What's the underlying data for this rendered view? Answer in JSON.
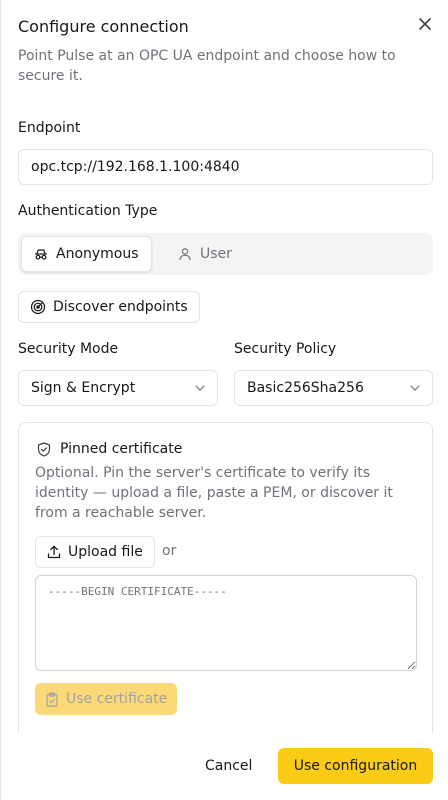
{
  "dialog": {
    "title": "Configure connection",
    "description": "Point Pulse at an OPC UA endpoint and choose how to secure it."
  },
  "endpoint": {
    "label": "Endpoint",
    "value": "opc.tcp://192.168.1.100:4840"
  },
  "auth": {
    "label": "Authentication Type",
    "options": [
      {
        "label": "Anonymous",
        "icon": "incognito-icon",
        "selected": true
      },
      {
        "label": "User",
        "icon": "user-icon",
        "selected": false
      }
    ]
  },
  "discover": {
    "label": "Discover endpoints",
    "icon": "radar-icon"
  },
  "security_mode": {
    "label": "Security Mode",
    "value": "Sign & Encrypt"
  },
  "security_policy": {
    "label": "Security Policy",
    "value": "Basic256Sha256"
  },
  "certificate": {
    "title": "Pinned certificate",
    "description": "Optional. Pin the server's certificate to verify its identity — upload a file, paste a PEM, or discover it from a reachable server.",
    "upload_label": "Upload file",
    "or_text": "or",
    "placeholder": "-----BEGIN CERTIFICATE-----",
    "use_label": "Use certificate"
  },
  "footer": {
    "cancel_label": "Cancel",
    "confirm_label": "Use configuration"
  },
  "colors": {
    "primary": "#facc15",
    "primary_disabled": "#fcd977",
    "muted_text": "#71717a",
    "border": "#e4e4e7"
  }
}
